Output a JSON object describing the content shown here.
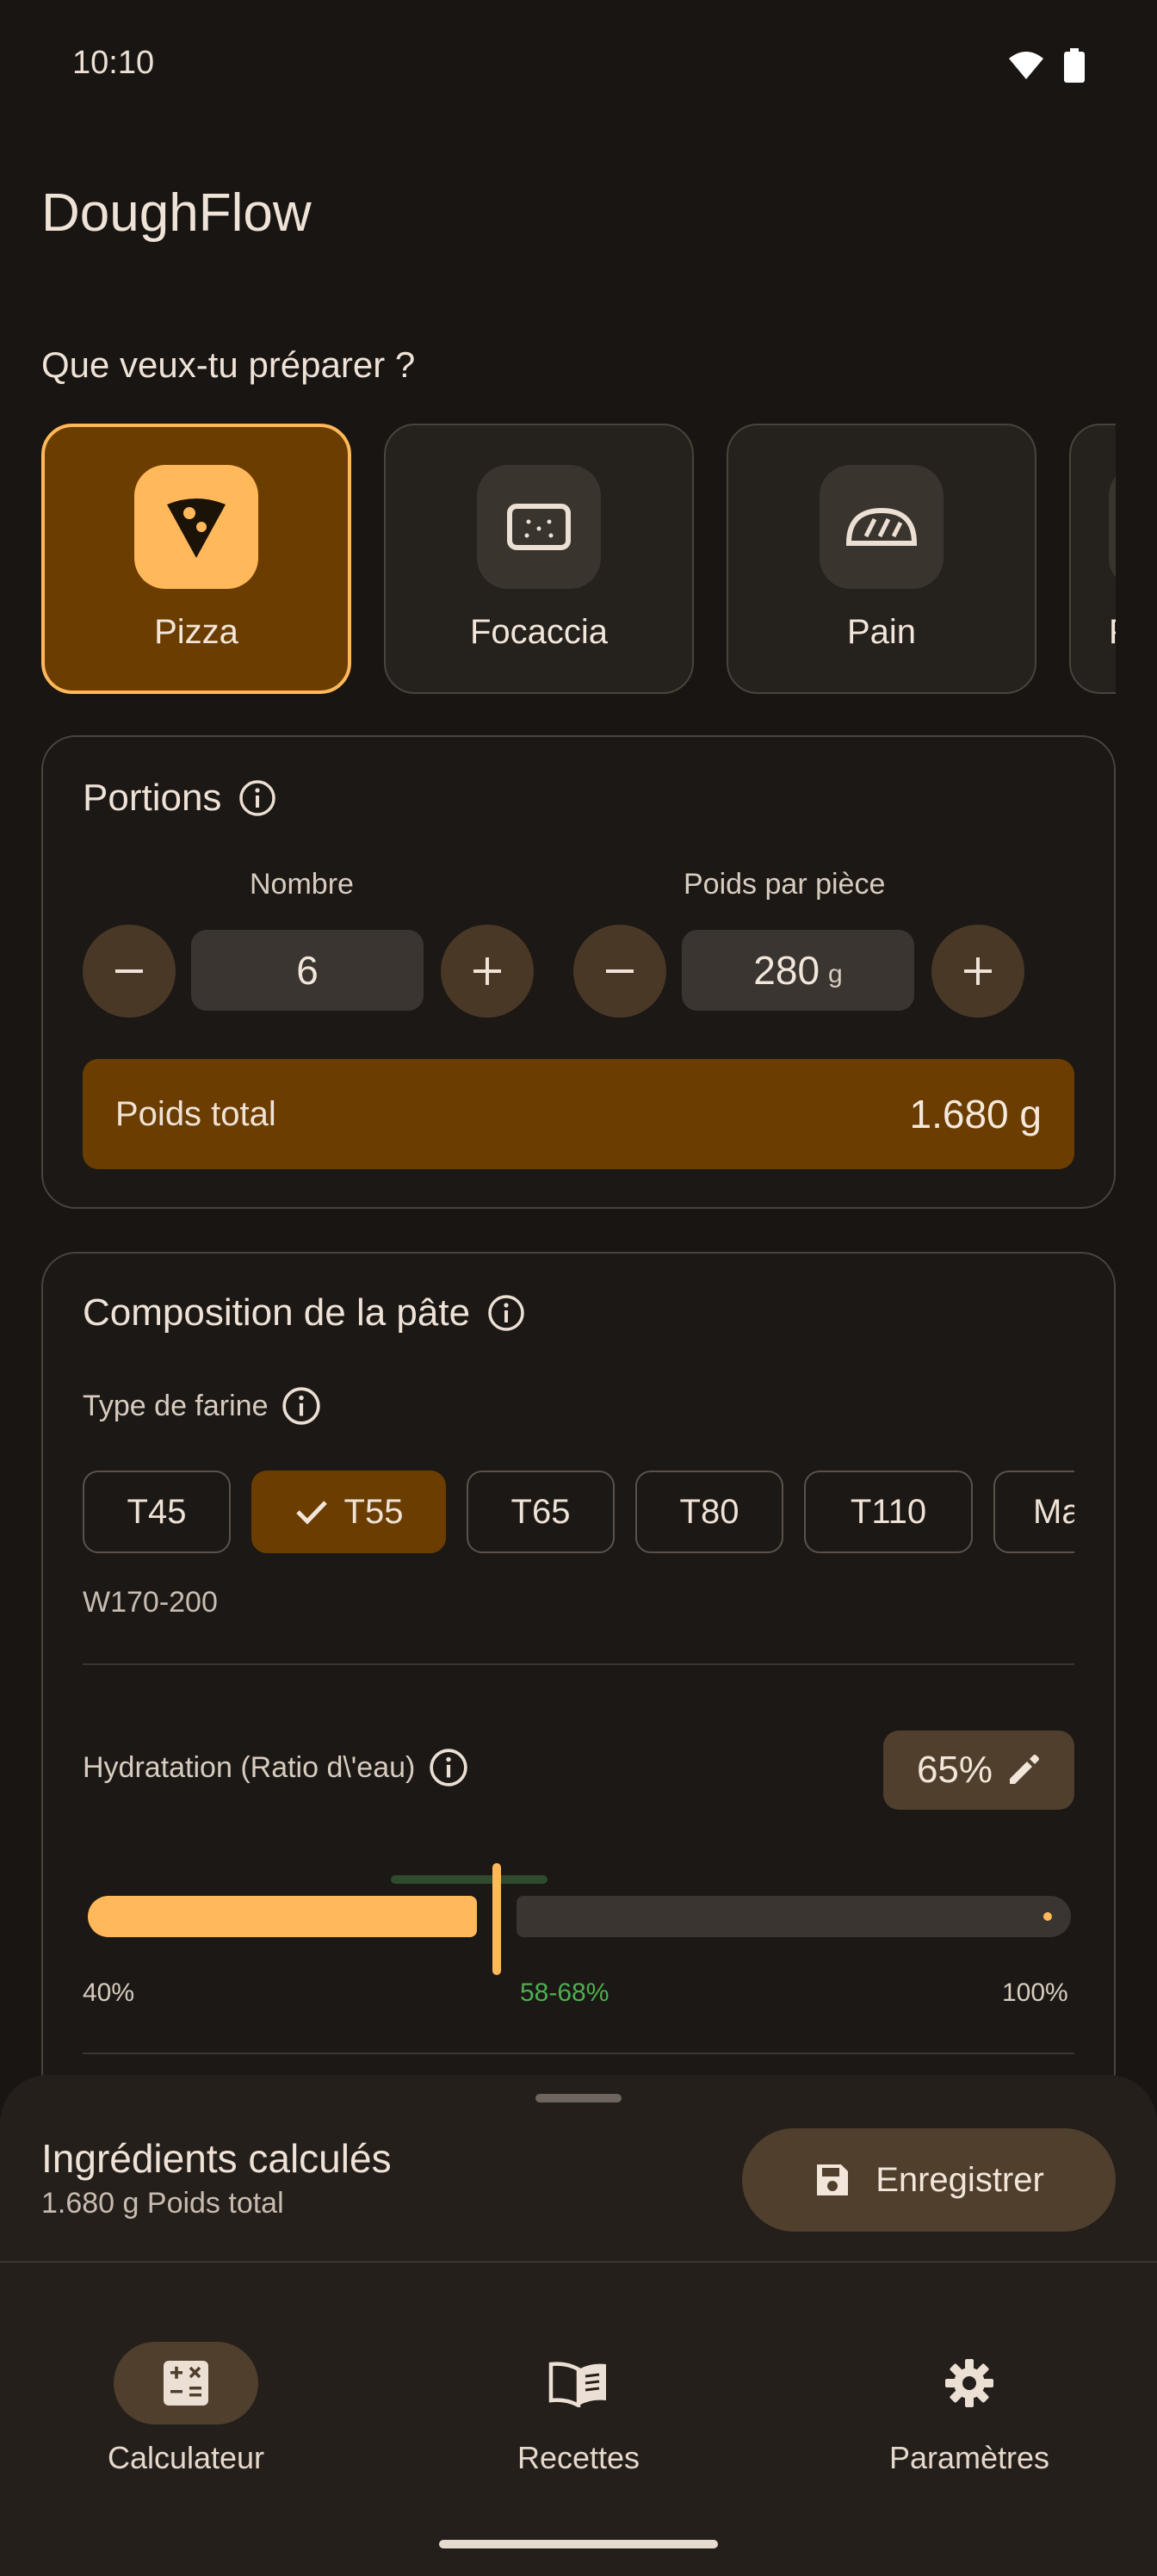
{
  "status": {
    "time": "10:10"
  },
  "app": {
    "title": "DoughFlow"
  },
  "prep": {
    "question": "Que veux-tu préparer ?",
    "types": [
      {
        "label": "Pizza",
        "icon": "pizza-icon",
        "selected": true
      },
      {
        "label": "Focaccia",
        "icon": "focaccia-icon",
        "selected": false
      },
      {
        "label": "Pain",
        "icon": "bread-icon",
        "selected": false
      },
      {
        "label": "P",
        "icon": "partial-icon",
        "selected": false
      }
    ]
  },
  "portions": {
    "title": "Portions",
    "count_label": "Nombre",
    "count_value": "6",
    "weight_label": "Poids par pièce",
    "weight_value": "280",
    "weight_unit": "g",
    "total_label": "Poids total",
    "total_value": "1.680 g"
  },
  "composition": {
    "title": "Composition de la pâte",
    "flour_label": "Type de farine",
    "flours": [
      "T45",
      "T55",
      "T65",
      "T80",
      "T110",
      "Ma"
    ],
    "selected_flour": "T55",
    "flour_strength": "W170-200",
    "hydration_label": "Hydratation (Ratio d\\'eau)",
    "hydration_value": "65%",
    "hydration_level": 0.65,
    "range_min": "40%",
    "range_recommended": "58-68%",
    "range_max": "100%"
  },
  "sheet": {
    "title": "Ingrédients calculés",
    "subtitle": "1.680 g Poids total",
    "save_label": "Enregistrer"
  },
  "nav": {
    "items": [
      {
        "label": "Calculateur",
        "icon": "calculator-icon",
        "active": true
      },
      {
        "label": "Recettes",
        "icon": "book-icon",
        "active": false
      },
      {
        "label": "Paramètres",
        "icon": "gear-icon",
        "active": false
      }
    ]
  },
  "colors": {
    "accent": "#ffb85a",
    "selected_bg": "#6b3d00",
    "recommended": "#4caf50",
    "background": "#181512"
  }
}
